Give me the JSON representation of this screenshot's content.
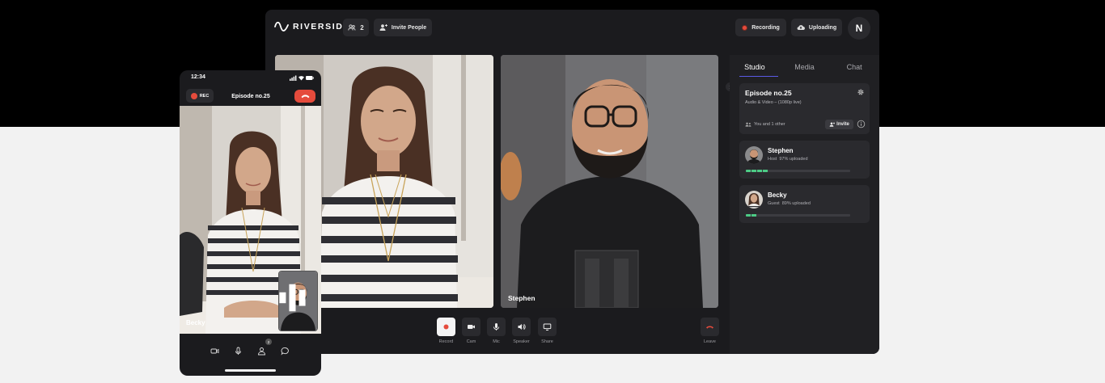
{
  "app": {
    "logo_text": "RIVERSIDE",
    "participants_count": "2",
    "invite_label": "Invite People",
    "recording_label": "Recording",
    "uploading_label": "Uploading",
    "avatar_initial": "N"
  },
  "stage": {
    "tiles": [
      {
        "name": ""
      },
      {
        "name": "Stephen"
      }
    ]
  },
  "controls": {
    "record": "Record",
    "cam": "Cam",
    "mic": "Mic",
    "speaker": "Speaker",
    "share": "Share",
    "leave": "Leave"
  },
  "sidebar": {
    "tabs": [
      {
        "label": "Studio",
        "active": true
      },
      {
        "label": "Media",
        "active": false
      },
      {
        "label": "Chat",
        "active": false
      }
    ],
    "episode": {
      "title": "Episode no.25",
      "subtitle": "Audio & Video – (1080p live)",
      "people": "You and 1 other",
      "invite": "Invite"
    },
    "members": [
      {
        "name": "Stephen",
        "role": "Host",
        "uploaded": "97% uploaded"
      },
      {
        "name": "Becky",
        "role": "Guest",
        "uploaded": "89% uploaded"
      }
    ]
  },
  "phone": {
    "time": "12:34",
    "rec": "REC",
    "title": "Episode no.25",
    "name": "Becky",
    "badge": "2"
  },
  "colors": {
    "accent": "#5a5ae6",
    "record_red": "#e54b3c",
    "upload_green": "#4ccb85",
    "panel": "#1b1b1e"
  }
}
